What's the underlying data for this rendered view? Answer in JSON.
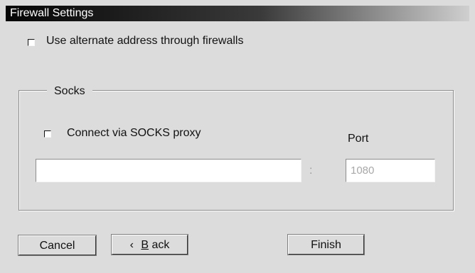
{
  "window": {
    "title": "Firewall Settings"
  },
  "options": {
    "alternate_address_label": "Use alternate address through firewalls"
  },
  "socks": {
    "group_title": "Socks",
    "proxy_label": "Connect via SOCKS proxy",
    "port_label": "Port",
    "host_value": "",
    "separator": ":",
    "port_value": "1080"
  },
  "buttons": {
    "cancel": "Cancel",
    "back_icon": "‹",
    "back_prefix": "",
    "back_mnemonic": "B",
    "back_suffix": "ack",
    "finish": "Finish"
  },
  "colors": {
    "title_start": "#050505",
    "title_end": "#cfcfcf",
    "window_bg": "#dcdcdc",
    "field_bg": "#ffffff",
    "disabled_text": "#a8a8a8"
  },
  "icons": {
    "checkbox": "checkbox-icon",
    "back_arrow": "chevron-left-icon"
  }
}
